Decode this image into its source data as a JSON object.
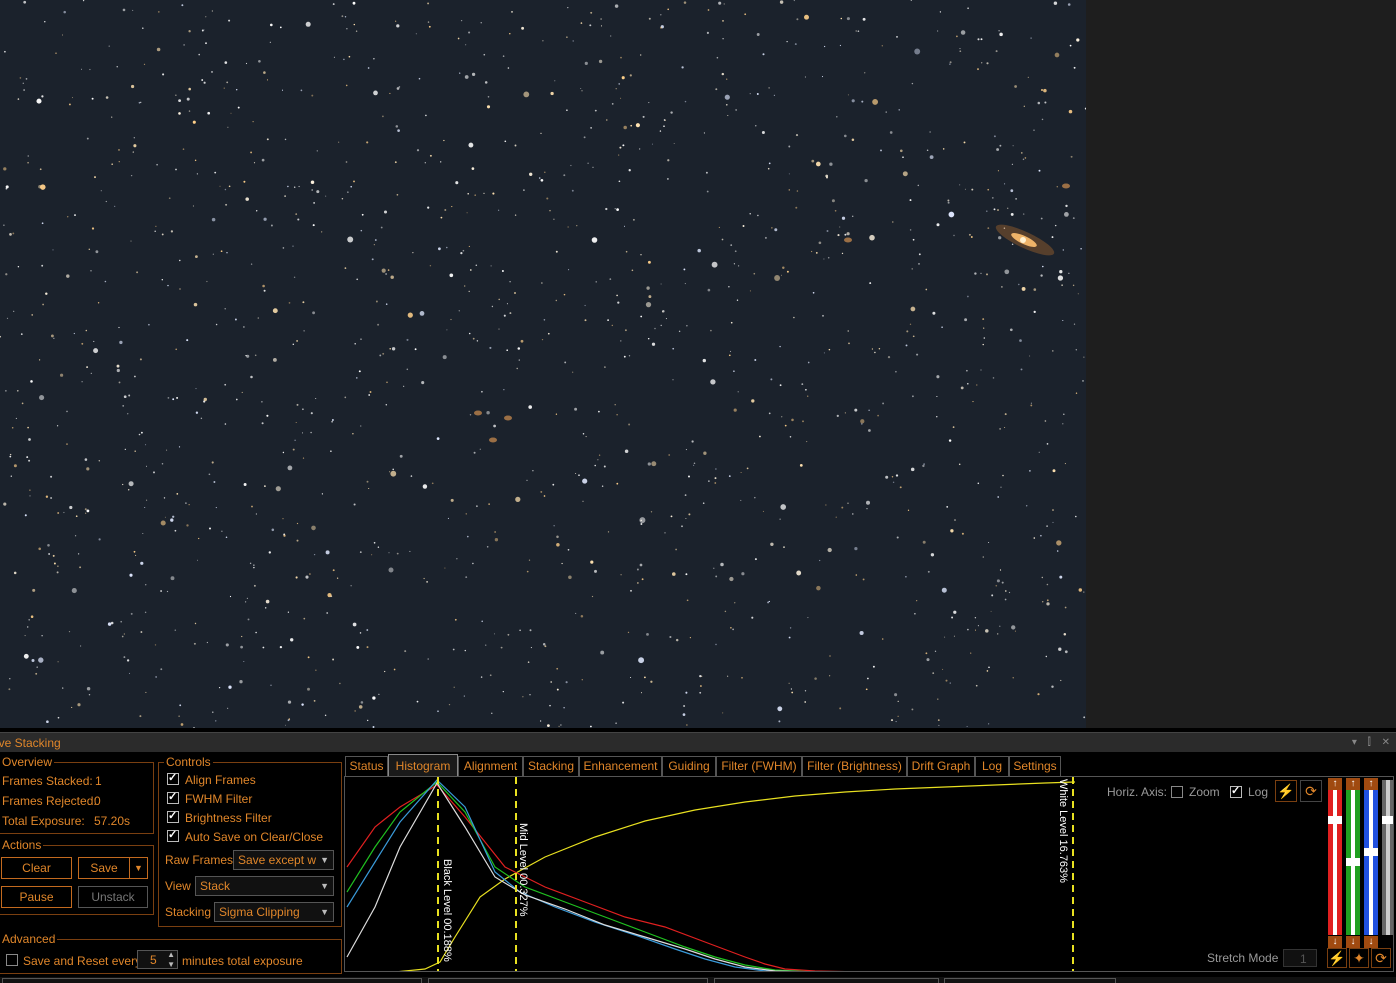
{
  "panel": {
    "title": "ive Stacking",
    "controls_glyphs": "▾ ⫿ ✕"
  },
  "overview": {
    "title": "Overview",
    "frames_stacked_label": "Frames Stacked:",
    "frames_stacked_value": "1",
    "frames_rejected_label": "Frames Rejected:",
    "frames_rejected_value": "0",
    "total_exposure_label": "Total Exposure:",
    "total_exposure_value": "57.20s"
  },
  "actions": {
    "title": "Actions",
    "clear": "Clear",
    "save": "Save",
    "pause": "Pause",
    "unstack": "Unstack"
  },
  "controls": {
    "title": "Controls",
    "align_frames": "Align Frames",
    "fwhm_filter": "FWHM Filter",
    "brightness_filter": "Brightness Filter",
    "auto_save": "Auto Save on Clear/Close",
    "raw_frames_label": "Raw Frames",
    "raw_frames_value": "Save except w",
    "view_label": "View",
    "view_value": "Stack",
    "stacking_label": "Stacking",
    "stacking_value": "Sigma Clipping"
  },
  "advanced": {
    "title": "Advanced",
    "save_reset_label": "Save and Reset every",
    "minutes_value": "5",
    "minutes_suffix": "minutes total exposure"
  },
  "tabs": [
    "Status",
    "Histogram",
    "Alignment",
    "Stacking",
    "Enhancement",
    "Guiding",
    "Filter (FWHM)",
    "Filter (Brightness)",
    "Drift Graph",
    "Log",
    "Settings"
  ],
  "histogram": {
    "horiz_axis_label": "Horiz. Axis:",
    "zoom_label": "Zoom",
    "log_label": "Log",
    "black_level": "Black Level  00.188%",
    "mid_level": "Mid Level  00.327%",
    "white_level": "White Level  16.763%",
    "stretch_mode_label": "Stretch Mode",
    "stretch_mode_value": "1",
    "colors": {
      "red": "#e02020",
      "green": "#20c020",
      "blue": "#3a9ad9",
      "white": "#dddddd",
      "yellow": "#e8e020"
    }
  },
  "icons": {
    "dropdown": "▼",
    "spin_up": "▲",
    "spin_down": "▼",
    "auto_stretch": "⚡",
    "reset": "⟳",
    "star": "✦",
    "arrow_up": "↑",
    "arrow_down": "↓"
  }
}
